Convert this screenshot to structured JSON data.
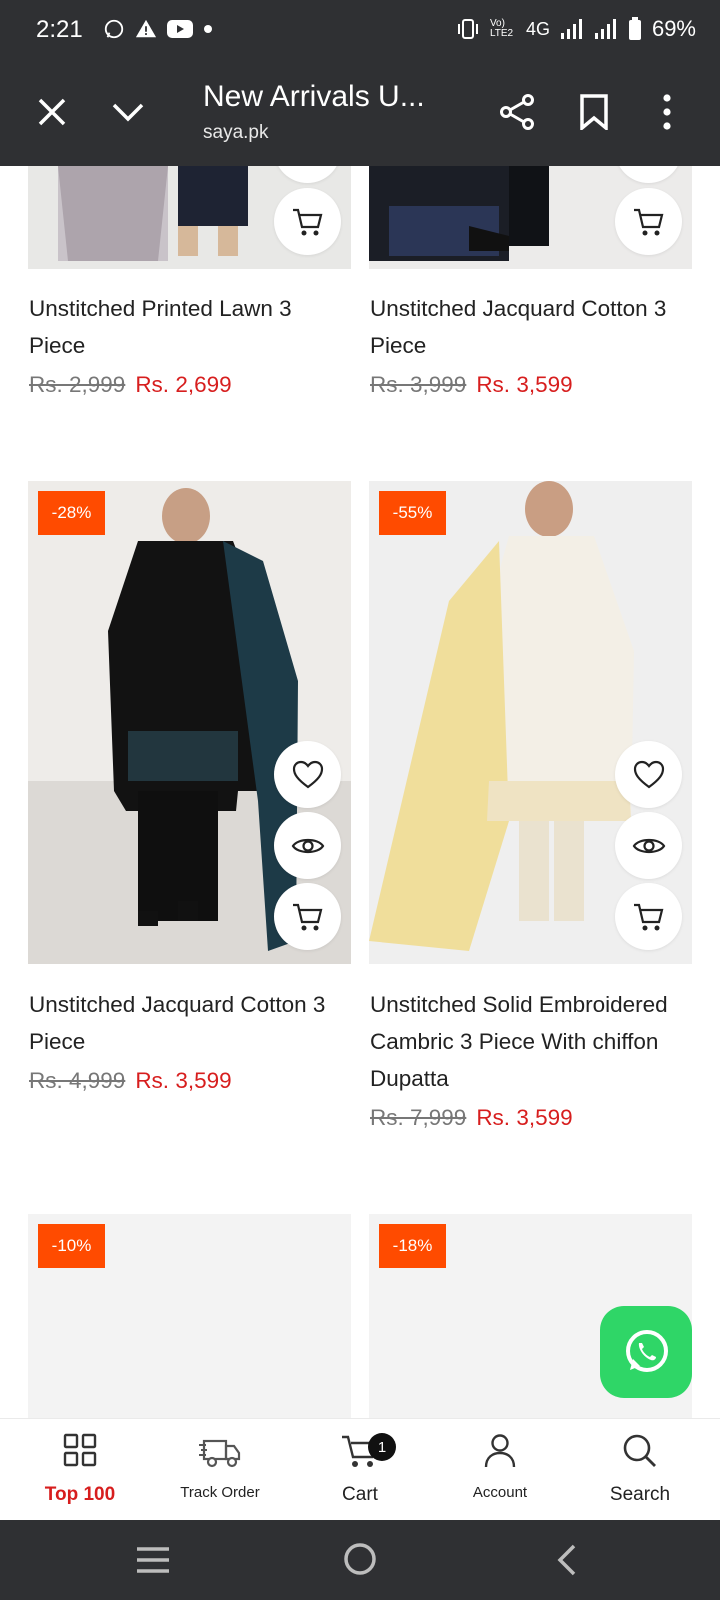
{
  "status": {
    "time": "2:21",
    "network": "4G",
    "volte": "Vo) LTE2",
    "battery": "69%"
  },
  "toolbar": {
    "title": "New Arrivals U...",
    "domain": "saya.pk"
  },
  "products": [
    {
      "title": "Unstitched Printed Lawn 3 Piece",
      "old_price": "Rs. 2,999",
      "new_price": "Rs. 2,699",
      "badge": ""
    },
    {
      "title": "Unstitched Jacquard Cotton 3 Piece",
      "old_price": "Rs. 3,999",
      "new_price": "Rs. 3,599",
      "badge": ""
    },
    {
      "title": "Unstitched Jacquard Cotton 3 Piece",
      "old_price": "Rs. 4,999",
      "new_price": "Rs. 3,599",
      "badge": "-28%"
    },
    {
      "title": "Unstitched Solid Embroidered Cambric 3 Piece With chiffon Dupatta",
      "old_price": "Rs. 7,999",
      "new_price": "Rs. 3,599",
      "badge": "-55%"
    },
    {
      "badge": "-10%"
    },
    {
      "badge": "-18%"
    }
  ],
  "bottom_nav": [
    {
      "label": "Top 100",
      "icon": "grid-icon",
      "active_color": "#d71e1e"
    },
    {
      "label": "Track Order",
      "icon": "truck-icon"
    },
    {
      "label": "Cart",
      "icon": "cart-icon",
      "badge": "1"
    },
    {
      "label": "Account",
      "icon": "user-icon"
    },
    {
      "label": "Search",
      "icon": "search-icon"
    }
  ],
  "colors": {
    "accent_red": "#d71e1e",
    "badge_orange": "#ff4b00",
    "whatsapp_green": "#2fd667",
    "chrome_dark": "#2f3033"
  }
}
